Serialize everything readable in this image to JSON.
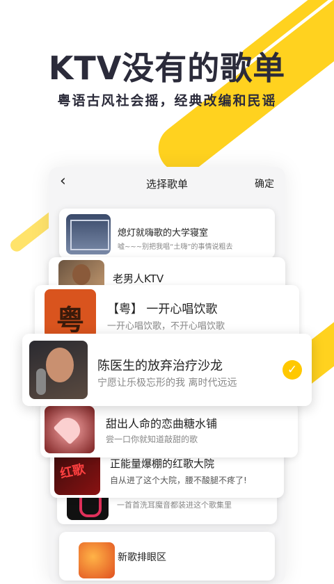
{
  "promo": {
    "headline": "KTV没有的歌单",
    "subheadline": "粤语古风社会摇，经典改编和民谣"
  },
  "nav": {
    "back_icon": "‹",
    "title": "选择歌单",
    "confirm_label": "确定"
  },
  "playlists": [
    {
      "title": "熄灯就嗨歌的大学寝室",
      "desc": "嘘~~~别把我唱“土嗨”的事情说粗去"
    },
    {
      "title": "老男人KTV",
      "desc": ""
    },
    {
      "title": "【粤】 一开心唱饮歌",
      "desc": "一开心唱饮歌，不开心唱饮歌",
      "thumb_char": "粤"
    },
    {
      "title": "陈医生的放弃治疗沙龙",
      "desc": "宁愿让乐极忘形的我 离时代远远",
      "selected": true
    },
    {
      "title": "甜出人命的恋曲糖水铺",
      "desc": "尝一口你就知道敲甜的歌"
    },
    {
      "title": "正能量爆棚的红歌大院",
      "desc": "自从进了这个大院，腰不酸腿不疼了!",
      "thumb_char": "红歌"
    },
    {
      "title": "",
      "desc": "一首首洗耳魔音都装进这个歌集里"
    },
    {
      "title": "新歌排眼区",
      "desc": ""
    }
  ],
  "colors": {
    "accent": "#ffc800",
    "headline": "#2b2b3a"
  }
}
